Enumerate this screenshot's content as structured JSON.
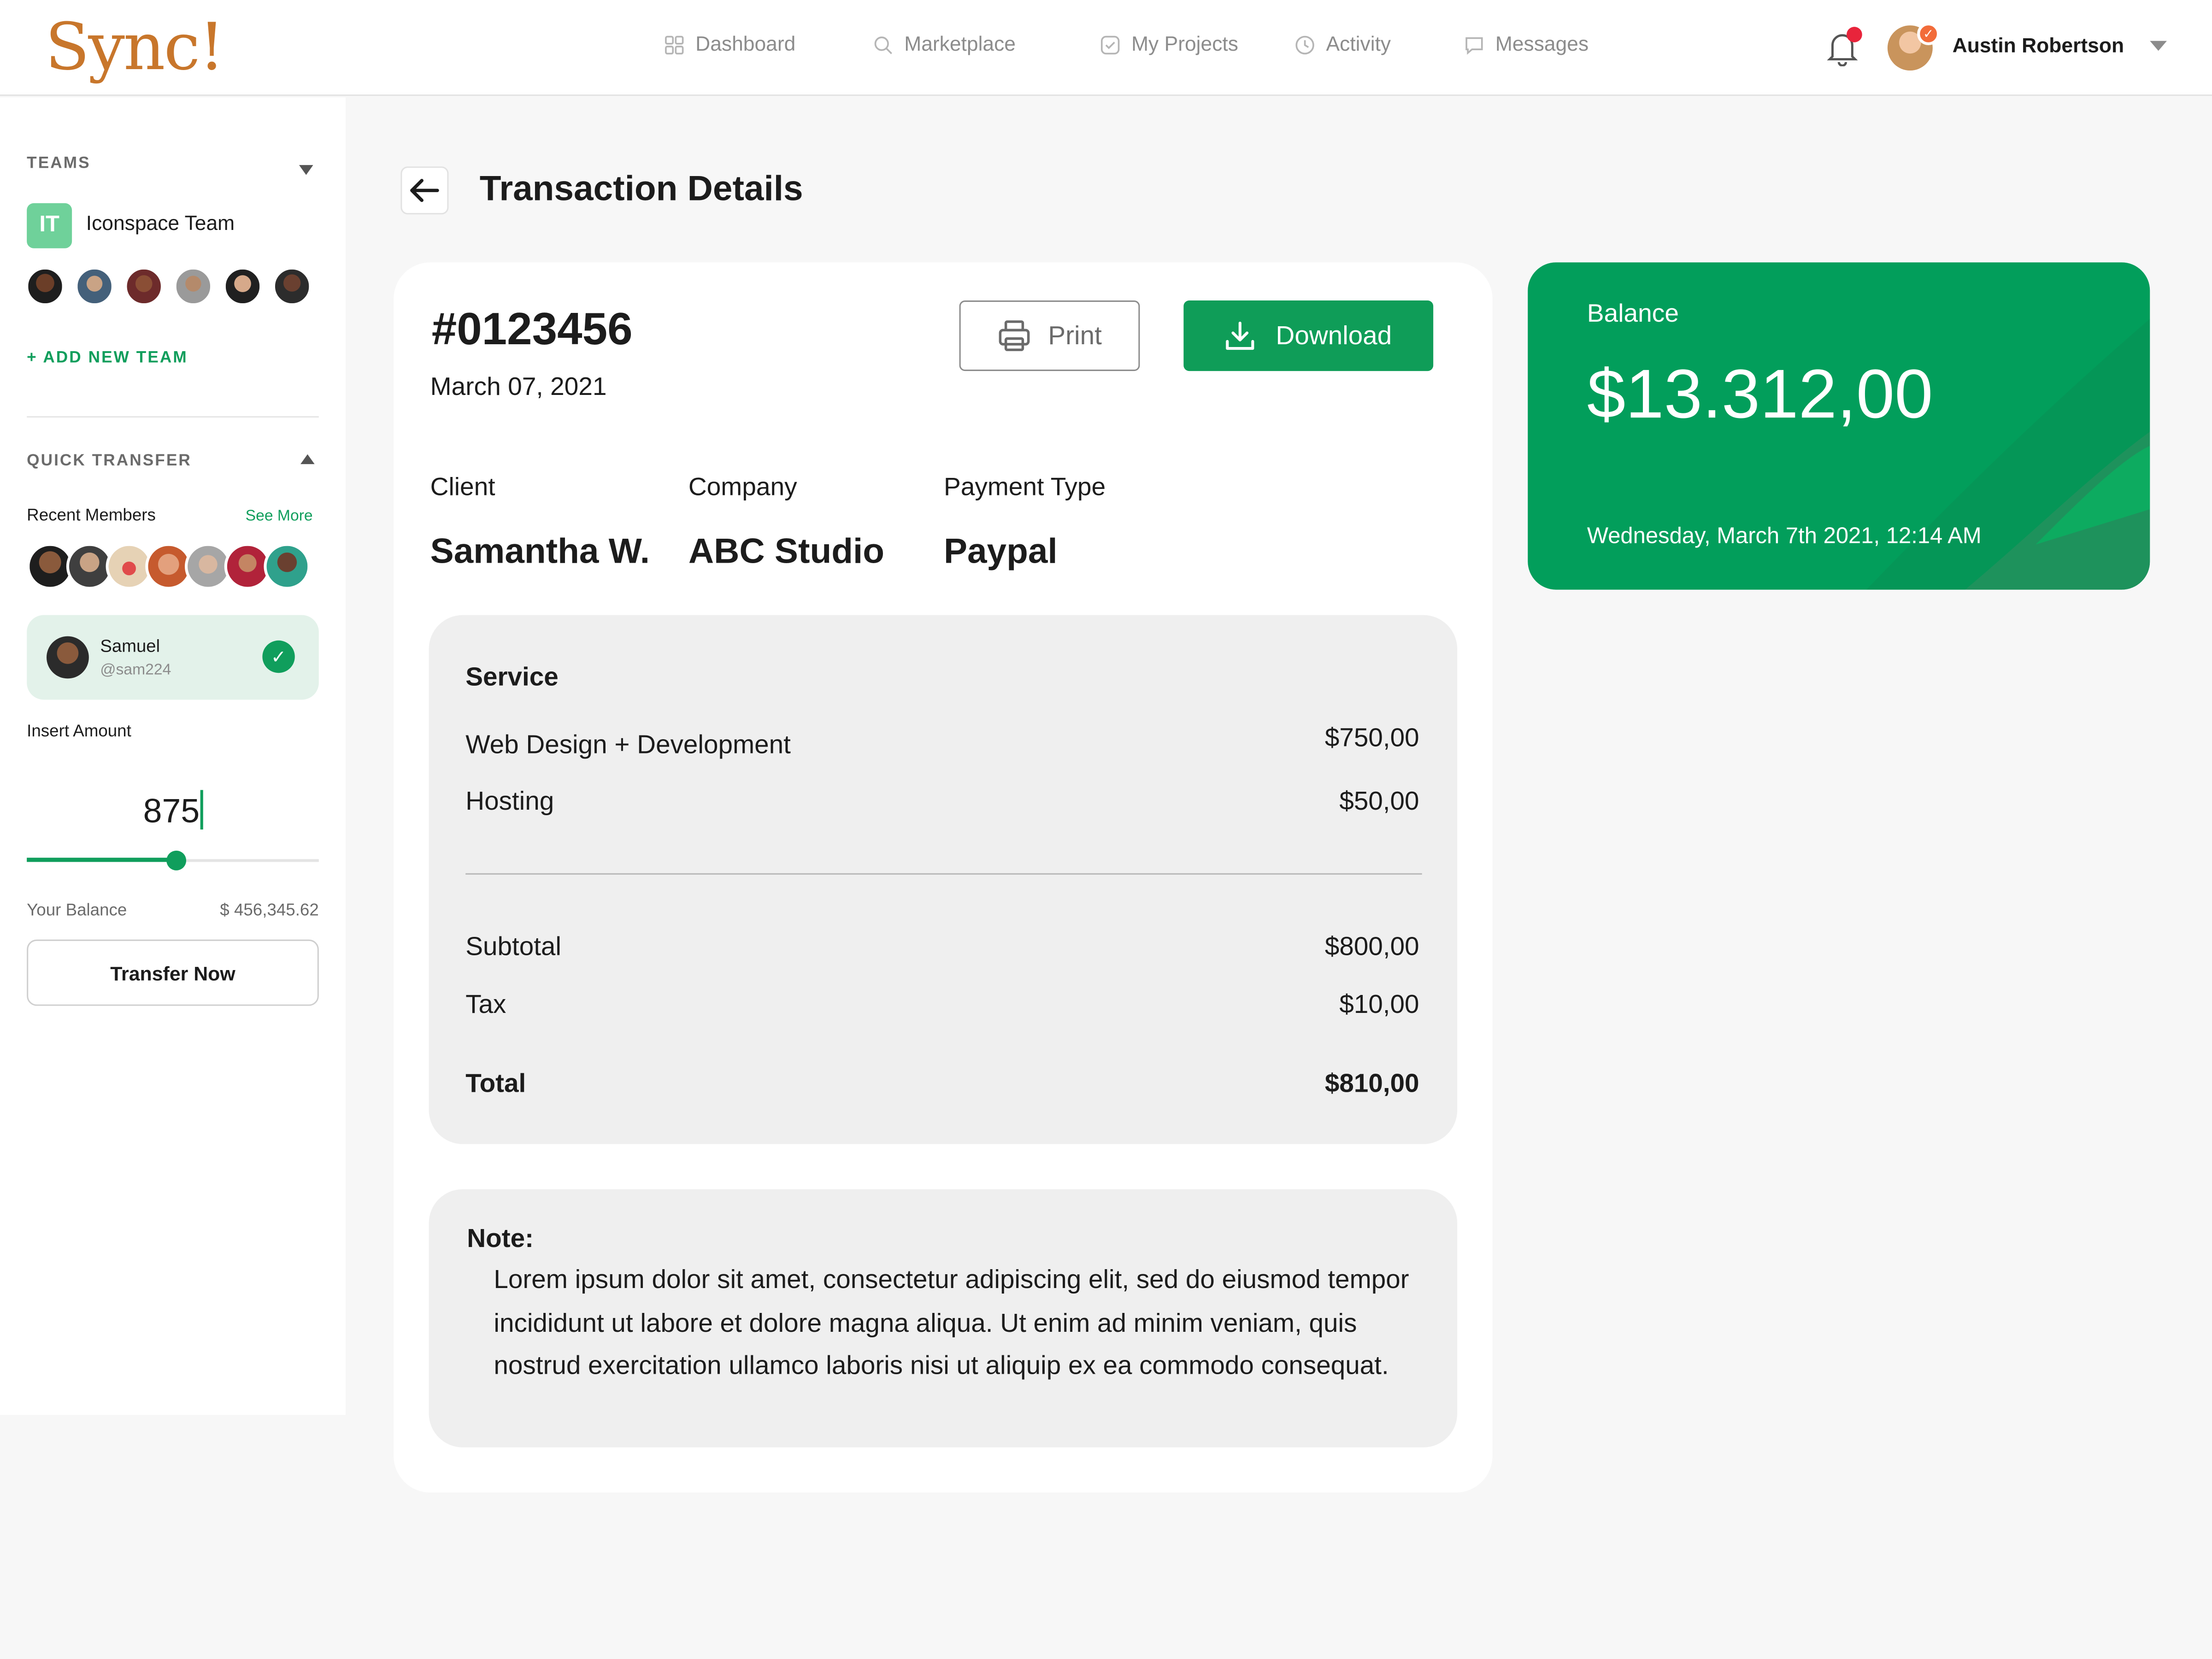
{
  "app": {
    "logo": "Sync!"
  },
  "nav": [
    {
      "label": "Dashboard",
      "icon": "grid-icon"
    },
    {
      "label": "Marketplace",
      "icon": "search-icon"
    },
    {
      "label": "My Projects",
      "icon": "checkbox-icon"
    },
    {
      "label": "Activity",
      "icon": "clock-icon"
    },
    {
      "label": "Messages",
      "icon": "chat-icon"
    }
  ],
  "user": {
    "name": "Austin Robertson"
  },
  "sidebar": {
    "teams_title": "TEAMS",
    "team": {
      "initials": "IT",
      "name": "Iconspace Team"
    },
    "add_team": "+ ADD NEW TEAM",
    "quick_transfer_title": "QUICK TRANSFER",
    "recent_members": "Recent Members",
    "see_more": "See More",
    "selected_member": {
      "name": "Samuel",
      "handle": "@sam224"
    },
    "insert_amount": "Insert Amount",
    "amount": "875",
    "slider_fraction": 0.51,
    "your_balance_label": "Your Balance",
    "your_balance_value": "$ 456,345.62",
    "transfer_button": "Transfer Now"
  },
  "page": {
    "title": "Transaction Details",
    "transaction_id": "#0123456",
    "date": "March 07, 2021",
    "print_label": "Print",
    "download_label": "Download",
    "meta": [
      {
        "label": "Client",
        "value": "Samantha W."
      },
      {
        "label": "Company",
        "value": "ABC Studio"
      },
      {
        "label": "Payment Type",
        "value": "Paypal"
      }
    ],
    "service_title": "Service",
    "services": [
      {
        "name": "Web Design + Development",
        "price": "$750,00"
      },
      {
        "name": "Hosting",
        "price": "$50,00"
      }
    ],
    "subtotal_label": "Subtotal",
    "subtotal": "$800,00",
    "tax_label": "Tax",
    "tax": "$10,00",
    "total_label": "Total",
    "total": "$810,00",
    "note_title": "Note:",
    "note_text": "Lorem ipsum dolor sit amet, consectetur adipiscing elit, sed do eiusmod tempor incididunt ut labore et dolore magna aliqua. Ut enim ad minim veniam, quis nostrud exercitation ullamco laboris nisi ut aliquip ex ea commodo consequat."
  },
  "balance": {
    "title": "Balance",
    "amount": "$13.312,00",
    "datetime": "Wednesday, March 7th 2021, 12:14 AM"
  },
  "colors": {
    "accent": "#0f9d58",
    "balance_card": "#029e5b",
    "logo": "#c8762b"
  }
}
